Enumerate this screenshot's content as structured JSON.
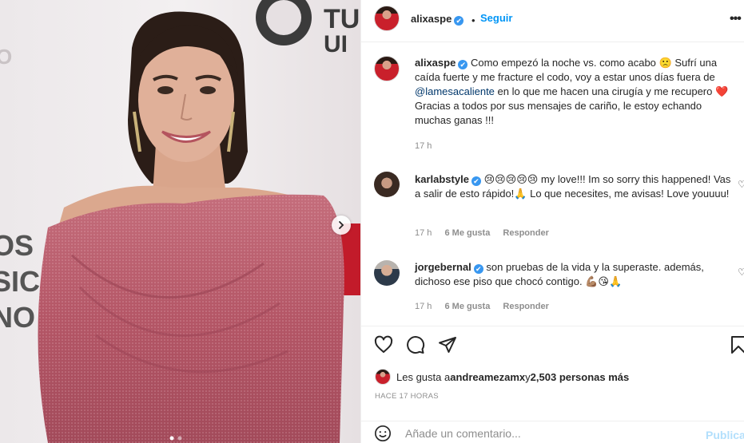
{
  "post": {
    "author": "alixaspe",
    "follow_label": "Seguir",
    "more_label": "•••",
    "verified_mark": "✔",
    "separator": "•"
  },
  "caption": {
    "username": "alixaspe",
    "text_1": "Como empezó la noche vs. como acabo 🙁 Sufrí una caída fuerte y me fracture el codo, voy a estar unos días fuera de ",
    "mention": "@lamesacaliente",
    "text_2": " en lo que me hacen una cirugía y me recupero ❤️ Gracias a todos por sus mensajes de cariño, le estoy echando muchas ganas !!!",
    "time": "17 h"
  },
  "comments": [
    {
      "username": "karlabstyle",
      "text": "😢😢😢😢😢 my love!!! Im so sorry this happened! Vas a salir de esto rápido!🙏 Lo que necesites, me avisas! Love youuuu!",
      "time": "17 h",
      "likes": "6 Me gusta",
      "reply": "Responder"
    },
    {
      "username": "jorgebernal",
      "text": "son pruebas de la vida y la superaste. además, dichoso ese piso que chocó contigo. 💪🏽😘🙏",
      "time": "17 h",
      "likes": "6 Me gusta",
      "reply": "Responder"
    }
  ],
  "likes": {
    "prefix": "Les gusta a ",
    "user": "andreamezamx",
    "middle": " y ",
    "count": "2,503 personas más"
  },
  "timestamp": "HACE 17 HORAS",
  "add_comment": {
    "placeholder": "Añade un comentario...",
    "publish_label": "Publicar"
  },
  "icons": {
    "like": "heart-icon",
    "comment": "comment-icon",
    "share": "send-icon",
    "save": "bookmark-icon",
    "emoji": "smiley-icon",
    "next": "chevron-right-icon"
  },
  "colors": {
    "accent": "#0095f6",
    "verified": "#3897f0",
    "mention": "#00376b",
    "muted": "#8e8e8e",
    "dress": "#b85a6a"
  }
}
